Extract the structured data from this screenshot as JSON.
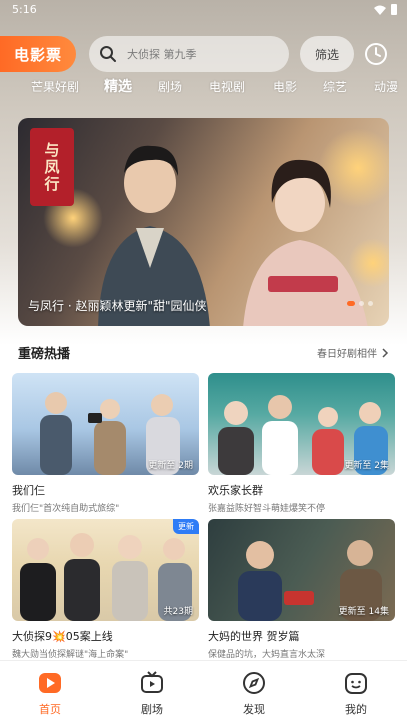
{
  "status_bar": {
    "time": "5:16"
  },
  "header": {
    "movie_ticket_label": "电影票",
    "search_placeholder": "大侦探 第九季",
    "filter_label": "筛选"
  },
  "nav": {
    "tabs": [
      "芒果好剧",
      "精选",
      "剧场",
      "电视剧",
      "电影",
      "综艺",
      "动漫"
    ],
    "active_index": 1
  },
  "banner": {
    "poster_title": "与凤行",
    "caption": "与凤行 · 赵丽颖林更新\"甜\"园仙侠",
    "slide_count": 3,
    "active_slide": 0
  },
  "section": {
    "title": "重磅热播",
    "more_label": "春日好剧相伴"
  },
  "cards": [
    {
      "title": "我们仨",
      "subtitle": "我们仨\"首次纯自助式旅综\"",
      "episode": "更新至 2期",
      "badge": ""
    },
    {
      "title": "欢乐家长群",
      "subtitle": "张嘉益陈好智斗萌娃爆笑不停",
      "episode": "更新至 2集",
      "badge": ""
    },
    {
      "title": "大侦探9💥05案上线",
      "subtitle": "魏大勋当侦探解谜\"海上命案\"",
      "episode": "共23期",
      "badge": "更新"
    },
    {
      "title": "大妈的世界 贺岁篇",
      "subtitle": "保健品的坑，大妈直言水太深",
      "episode": "更新至 14集",
      "badge": ""
    }
  ],
  "tabbar": {
    "items": [
      "首页",
      "剧场",
      "发现",
      "我的"
    ],
    "active_index": 0
  },
  "colors": {
    "accent": "#ff6a25",
    "badge_blue": "#2e7cf6"
  }
}
